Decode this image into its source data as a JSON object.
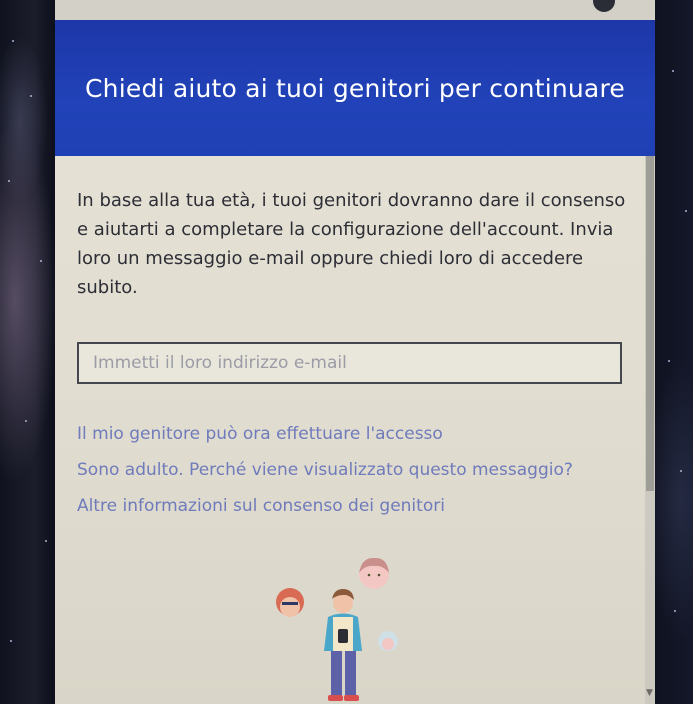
{
  "dialog": {
    "title": "Chiedi aiuto ai tuoi genitori per continuare",
    "body": "In base alla tua età, i tuoi genitori dovranno dare il consenso e aiutarti a completare la configurazione dell'account. Invia loro un messaggio e-mail oppure chiedi loro di accedere subito.",
    "email": {
      "placeholder": "Immetti il loro indirizzo e-mail",
      "value": ""
    },
    "links": [
      "Il mio genitore può ora effettuare l'accesso",
      "Sono adulto. Perché viene visualizzato questo messaggio?",
      "Altre informazioni sul consenso dei genitori"
    ]
  },
  "colors": {
    "header_blue": "#1f3fb4",
    "link": "#6f7bbb",
    "text": "#2d2e36"
  },
  "icons": [
    "family-illustration",
    "scroll-down-arrow-icon"
  ]
}
